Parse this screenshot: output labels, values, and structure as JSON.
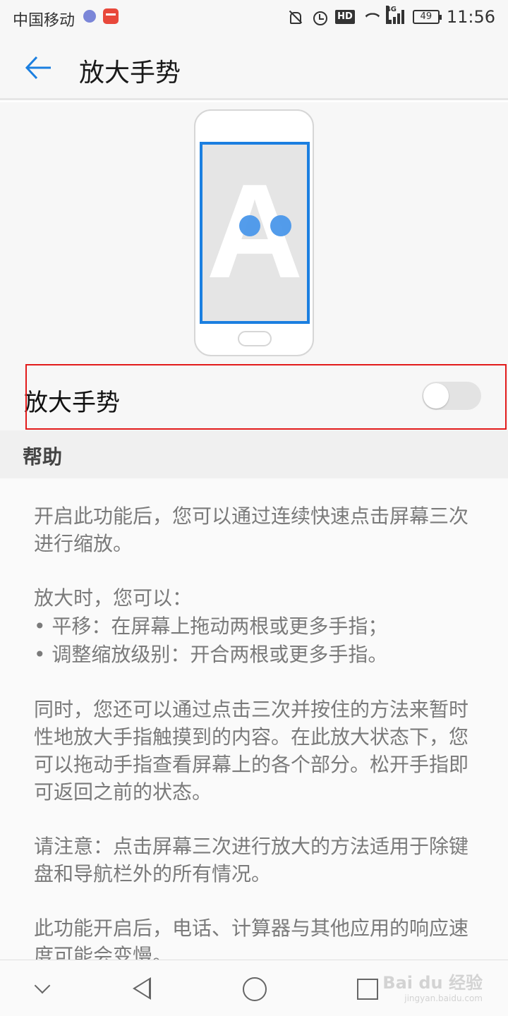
{
  "status_bar": {
    "carrier": "中国移动",
    "hd_label": "HD",
    "network_label": "4G",
    "battery_level": "49",
    "time": "11:56"
  },
  "header": {
    "title": "放大手势"
  },
  "illustration": {
    "letter": "A"
  },
  "toggle_row": {
    "label": "放大手势",
    "enabled": false
  },
  "help": {
    "title": "帮助",
    "paragraphs": [
      "开启此功能后，您可以通过连续快速点击屏幕三次进行缩放。",
      "放大时，您可以：",
      "• 平移：在屏幕上拖动两根或更多手指；",
      "• 调整缩放级别：开合两根或更多手指。",
      "同时，您还可以通过点击三次并按住的方法来暂时性地放大手指触摸到的内容。在此放大状态下，您可以拖动手指查看屏幕上的各个部分。松开手指即可返回之前的状态。",
      "请注意：点击屏幕三次进行放大的方法适用于除键盘和导航栏外的所有情况。",
      "此功能开启后，电话、计算器与其他应用的响应速度可能会变慢。"
    ]
  },
  "watermark": {
    "brand": "Bai du 经验",
    "url": "jingyan.baidu.com"
  },
  "colors": {
    "accent": "#1b7fe0",
    "highlight": "#e21b1b"
  }
}
